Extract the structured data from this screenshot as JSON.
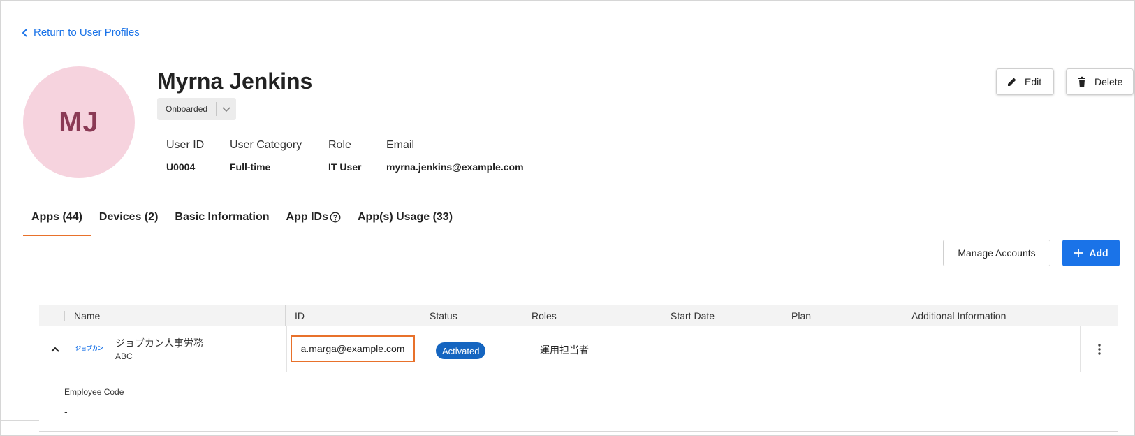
{
  "nav": {
    "back_label": "Return to User Profiles"
  },
  "profile": {
    "initials": "MJ",
    "name": "Myrna Jenkins",
    "status": "Onboarded",
    "fields": [
      {
        "label": "User ID",
        "value": "U0004"
      },
      {
        "label": "User Category",
        "value": "Full-time"
      },
      {
        "label": "Role",
        "value": "IT User"
      },
      {
        "label": "Email",
        "value": "myrna.jenkins@example.com"
      }
    ]
  },
  "actions": {
    "edit_label": "Edit",
    "delete_label": "Delete"
  },
  "tabs": [
    {
      "label": "Apps (44)",
      "active": true
    },
    {
      "label": "Devices (2)"
    },
    {
      "label": "Basic Information"
    },
    {
      "label": "App IDs"
    },
    {
      "label": "App(s) Usage (33)"
    }
  ],
  "toolbar": {
    "manage_label": "Manage Accounts",
    "add_label": "Add"
  },
  "table": {
    "columns": [
      "Name",
      "ID",
      "Status",
      "Roles",
      "Start Date",
      "Plan",
      "Additional Information"
    ],
    "rows": [
      {
        "logo_text": "ジョブカン",
        "name": "ジョブカン人事労務",
        "sub": "ABC",
        "id": "a.marga@example.com",
        "status": "Activated",
        "roles": "運用担当者",
        "start_date": "",
        "plan": "",
        "additional": ""
      }
    ],
    "detail": {
      "label": "Employee Code",
      "value": "-"
    }
  },
  "colors": {
    "accent": "#1a73e8",
    "tab_underline": "#e8712b",
    "status_badge": "#1565c0",
    "avatar_bg": "#f6d3de",
    "avatar_text": "#8a3a55"
  },
  "icons": [
    "chevron-left-icon",
    "chevron-down-icon",
    "pencil-icon",
    "trash-icon",
    "help-circle-icon",
    "plus-icon",
    "chevron-up-icon",
    "more-vertical-icon"
  ]
}
